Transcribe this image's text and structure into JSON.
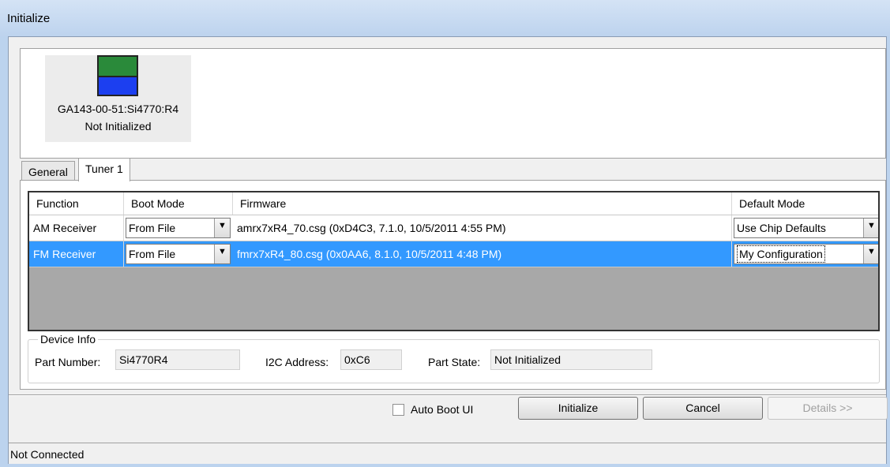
{
  "window": {
    "title": "Initialize"
  },
  "device": {
    "name": "GA143-00-51:Si4770:R4",
    "status": "Not Initialized"
  },
  "tabs": [
    {
      "label": "General",
      "active": false
    },
    {
      "label": "Tuner 1",
      "active": true
    }
  ],
  "grid": {
    "columns": [
      "Function",
      "Boot Mode",
      "Firmware",
      "Default Mode"
    ],
    "rows": [
      {
        "function": "AM Receiver",
        "boot_mode": "From File",
        "firmware": "amrx7xR4_70.csg (0xD4C3, 7.1.0, 10/5/2011 4:55 PM)",
        "default_mode": "Use Chip Defaults",
        "selected": false
      },
      {
        "function": "FM Receiver",
        "boot_mode": "From File",
        "firmware": "fmrx7xR4_80.csg (0x0AA6, 8.1.0, 10/5/2011 4:48 PM)",
        "default_mode": "My Configuration",
        "selected": true
      }
    ]
  },
  "device_info": {
    "legend": "Device Info",
    "part_number_label": "Part Number:",
    "part_number": "Si4770R4",
    "i2c_label": "I2C Address:",
    "i2c_address": "0xC6",
    "part_state_label": "Part State:",
    "part_state": "Not Initialized"
  },
  "actions": {
    "auto_boot_label": "Auto Boot UI",
    "initialize": "Initialize",
    "cancel": "Cancel",
    "details": "Details >>"
  },
  "statusbar": {
    "text": "Not Connected"
  },
  "colors": {
    "selection": "#3399ff",
    "chip_top": "#2a8a3a",
    "chip_bottom": "#1c3ff0"
  },
  "icons": {
    "dropdown": "chevron-down-icon",
    "device": "chip-icon"
  }
}
